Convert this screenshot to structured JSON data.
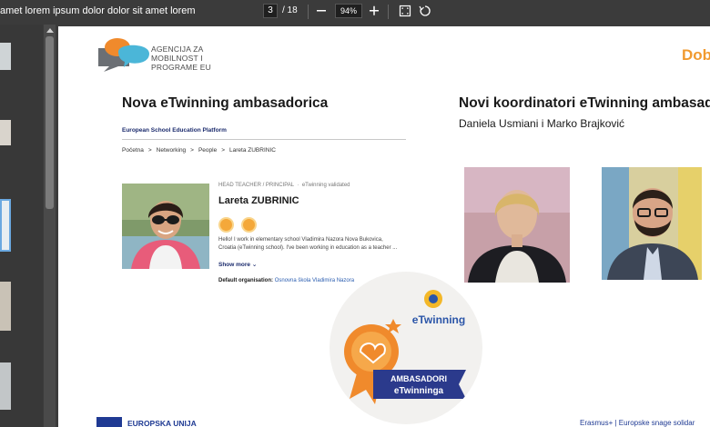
{
  "viewer": {
    "doc_title": "amet lorem ipsum dolor dolor sit amet lorem",
    "page_current": "3",
    "page_total": "/ 18",
    "zoom": "94%",
    "zoom_out_icon": "minus-icon",
    "zoom_in_icon": "plus-icon",
    "fit_page_icon": "fit-page-icon",
    "rotate_icon": "rotate-icon"
  },
  "slide": {
    "logo_text": [
      "AGENCIJA ZA",
      "MOBILNOST I",
      "PROGRAME EU"
    ],
    "corner_text": "Dob",
    "left_heading": "Nova eTwinning ambasadorica",
    "right_heading": "Novi koordinatori eTwinning ambasad",
    "right_subheading": "Daniela Usmiani i Marko Brajković",
    "profile": {
      "platform": "European School Education Platform",
      "breadcrumbs": [
        "Početna",
        ">",
        "Networking",
        ">",
        "People",
        ">",
        "Lareta ZUBRINIC"
      ],
      "role": "HEAD TEACHER / PRINCIPAL",
      "validated": "eTwinning validated",
      "name": "Lareta ZUBRINIC",
      "bio_line1": "Hello! I work in elementary school Vladimira Nazora Nova Bukovica,",
      "bio_line2": "Croatia (eTwinning school). I've been working in education as a teacher ...",
      "show_more": "Show more",
      "org_label": "Default organisation:",
      "org_value": "Osnovna škola Vladimira Nazora"
    },
    "badge": {
      "etwinning": "eTwinning",
      "ribbon_line1": "AMBASADORI",
      "ribbon_line2": "eTwinninga"
    },
    "footer_left": "EUROPSKA UNIJA",
    "footer_right": "Erasmus+ | Europske snage solidar"
  }
}
